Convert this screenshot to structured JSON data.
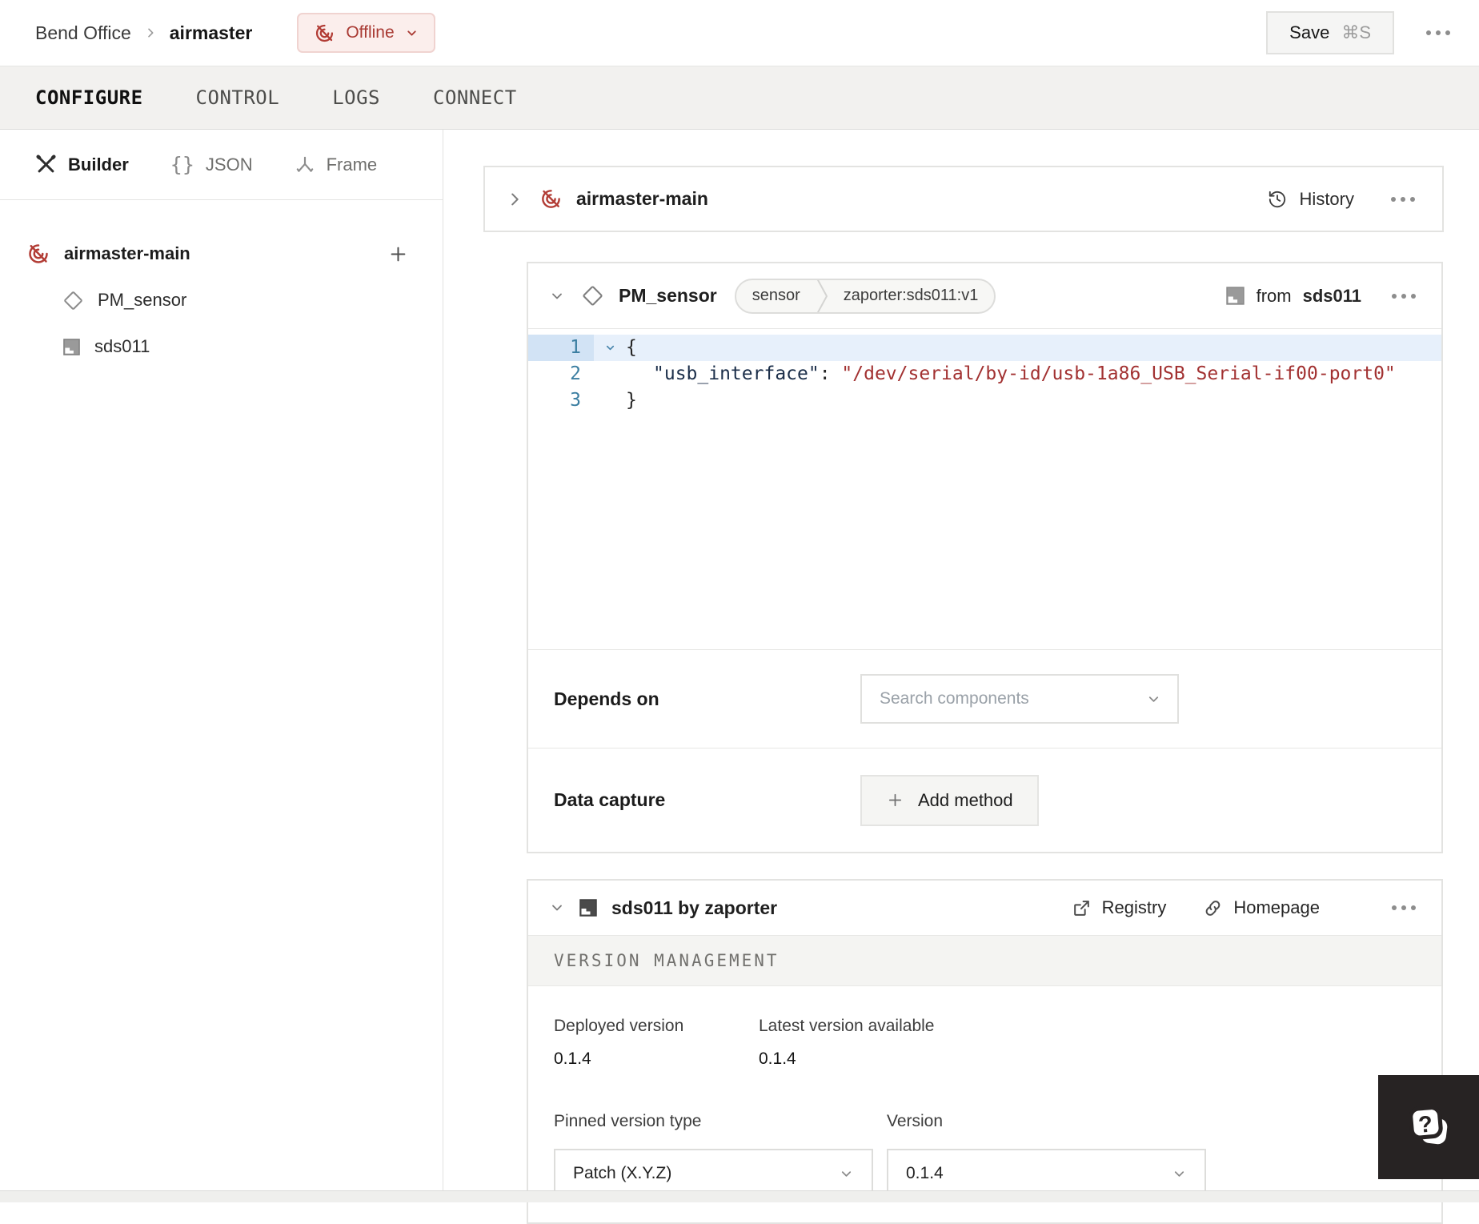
{
  "header": {
    "breadcrumb_parent": "Bend Office",
    "breadcrumb_current": "airmaster",
    "status_label": "Offline",
    "save_label": "Save",
    "save_shortcut": "⌘S"
  },
  "tabs": [
    {
      "label": "CONFIGURE",
      "active": true
    },
    {
      "label": "CONTROL",
      "active": false
    },
    {
      "label": "LOGS",
      "active": false
    },
    {
      "label": "CONNECT",
      "active": false
    }
  ],
  "sidebar": {
    "views": [
      {
        "label": "Builder",
        "icon": "tools-icon",
        "active": true
      },
      {
        "label": "JSON",
        "icon": "braces-icon",
        "active": false
      },
      {
        "label": "Frame",
        "icon": "frame-axes-icon",
        "active": false
      }
    ],
    "tree": {
      "root_label": "airmaster-main",
      "children": [
        {
          "label": "PM_sensor",
          "icon": "component-diamond-icon"
        },
        {
          "label": "sds011",
          "icon": "module-icon"
        }
      ]
    }
  },
  "machine_card": {
    "title": "airmaster-main",
    "history_label": "History"
  },
  "component_card": {
    "title": "PM_sensor",
    "type_tag": "sensor",
    "model_tag": "zaporter:sds011:v1",
    "from_label": "from",
    "from_module": "sds011",
    "editor": {
      "line_numbers": [
        "1",
        "2",
        "3"
      ],
      "line1": "{",
      "line2_key": "\"usb_interface\"",
      "line2_separator": ": ",
      "line2_value": "\"/dev/serial/by-id/usb-1a86_USB_Serial-if00-port0\"",
      "line3": "}"
    },
    "depends_on_label": "Depends on",
    "depends_on_placeholder": "Search components",
    "data_capture_label": "Data capture",
    "add_method_label": "Add method"
  },
  "module_card": {
    "title": "sds011 by zaporter",
    "registry_label": "Registry",
    "homepage_label": "Homepage",
    "section_title": "VERSION MANAGEMENT",
    "deployed_version_label": "Deployed version",
    "deployed_version": "0.1.4",
    "latest_version_label": "Latest version available",
    "latest_version": "0.1.4",
    "pinned_version_type_label": "Pinned version type",
    "pinned_version_type": "Patch (X.Y.Z)",
    "version_label": "Version",
    "version": "0.1.4"
  },
  "colors": {
    "offline_red": "#a93a33",
    "offline_badge_bg": "#fbeeec",
    "code_key": "#1c2f4a",
    "code_string": "#a23131",
    "line_number_blue": "#3b7ea1",
    "active_line_bg": "#e7f0fb",
    "tabbar_bg": "#f2f1ef",
    "help_fab_bg": "#272323"
  }
}
